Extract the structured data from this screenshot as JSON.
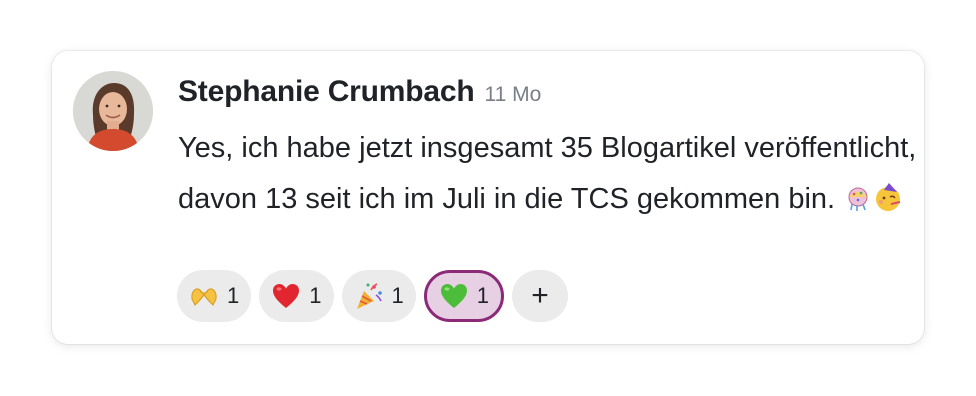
{
  "comment": {
    "author": "Stephanie Crumbach",
    "time": "11 Mo",
    "message": "Yes, ich habe jetzt insgesamt 35 Blogartikel veröffentlicht, davon 13 seit ich im Juli in die TCS gekommen bin.",
    "message_emojis": [
      "confetti-ball-icon",
      "partying-face-icon"
    ]
  },
  "reactions": [
    {
      "icon": "heart-hands-icon",
      "count": "1",
      "active": false
    },
    {
      "icon": "red-heart-icon",
      "count": "1",
      "active": false
    },
    {
      "icon": "party-popper-icon",
      "count": "1",
      "active": false
    },
    {
      "icon": "green-heart-icon",
      "count": "1",
      "active": true
    }
  ],
  "add_reaction": {
    "label": "+"
  },
  "colors": {
    "active_border": "#8b2a78",
    "active_background": "#e7cfe4",
    "chip_background": "#ebebeb",
    "text": "#1f2227",
    "muted": "#7a7e86"
  }
}
